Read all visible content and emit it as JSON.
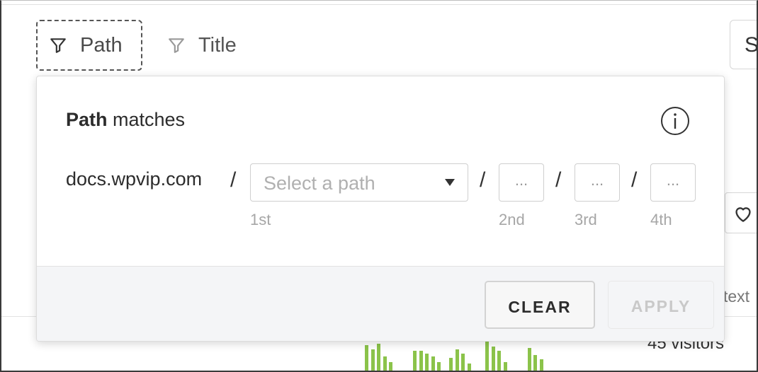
{
  "filters": {
    "path_label": "Path",
    "title_label": "Title",
    "filter_icon": "filter-funnel-icon"
  },
  "background": {
    "right_button_text": "S",
    "text_snippet": "text",
    "visitors_text": "45 visitors",
    "heart_icon": "heart-icon",
    "bar_color": "#8bc34a"
  },
  "popover": {
    "title_bold": "Path",
    "title_rest": " matches",
    "info_icon": "info-icon",
    "domain": "docs.wpvip.com",
    "separator": "/",
    "select": {
      "placeholder": "Select a path",
      "label": "1st"
    },
    "segments": [
      {
        "value": "...",
        "label": "2nd"
      },
      {
        "value": "...",
        "label": "3rd"
      },
      {
        "value": "...",
        "label": "4th"
      }
    ],
    "buttons": {
      "clear": "CLEAR",
      "apply": "APPLY"
    }
  }
}
